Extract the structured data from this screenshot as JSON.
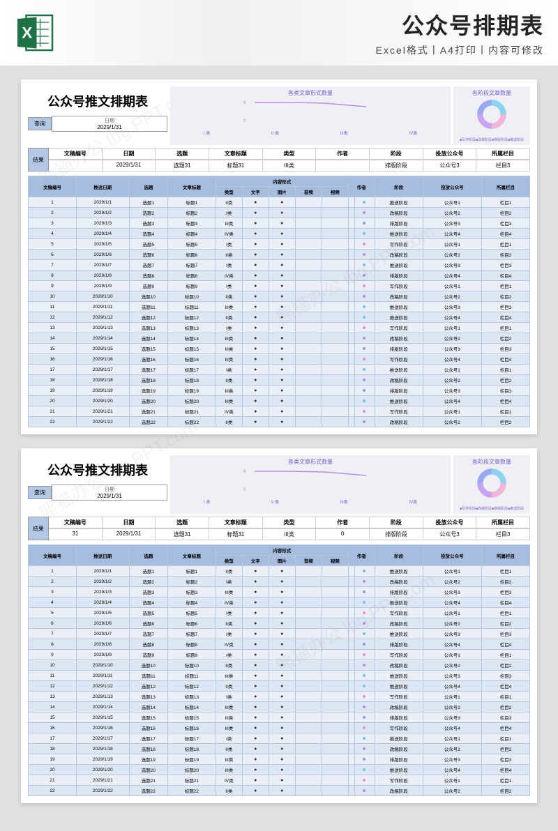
{
  "banner": {
    "title": "公众号排期表",
    "subtitle": "Excel格式丨A4打印丨内容可修改"
  },
  "sheetTitle": "公众号推文排期表",
  "query": {
    "label": "查询",
    "dateLabel": "日期",
    "date": "2029/1/31"
  },
  "result": {
    "label": "结果",
    "headers": [
      "文稿编号",
      "日期",
      "选题",
      "文章标题",
      "类型",
      "作者",
      "阶段",
      "投放公众号",
      "所属栏目"
    ],
    "values1": [
      "",
      "2029/1/31",
      "选题31",
      "标题31",
      "III类",
      "",
      "排版阶段",
      "公众号3",
      "栏目3"
    ],
    "values2": [
      "31",
      "2029/1/31",
      "选题31",
      "标题31",
      "III类",
      "0",
      "排版阶段",
      "公众号3",
      "栏目3"
    ]
  },
  "chart_data": [
    {
      "type": "line",
      "title": "各类文章形式数量",
      "categories": [
        "I 类",
        "II 类",
        "III类",
        "IV类"
      ],
      "values": [
        8,
        8,
        8,
        7
      ],
      "ylim": [
        0,
        8
      ],
      "yticks": [
        0,
        8
      ],
      "colors": {
        "line": "#b98ce8"
      }
    },
    {
      "type": "donut",
      "title": "各阶段文章数量",
      "series": [
        {
          "name": "写作阶段",
          "value": 25,
          "color": "#f0b5d8"
        },
        {
          "name": "改稿阶段",
          "value": 25,
          "color": "#c9a3ef"
        },
        {
          "name": "排版阶段",
          "value": 25,
          "color": "#9aa8f2"
        },
        {
          "name": "推送阶段",
          "value": 25,
          "color": "#8dd3ef"
        }
      ],
      "legend_labels": [
        "写作阶段",
        "改稿阶段",
        "排版阶段",
        "推送阶段"
      ]
    }
  ],
  "tableHeaders": {
    "id": "文稿编号",
    "date": "推送日期",
    "topic": "选题",
    "title": "文章标题",
    "formGroup": "内容形式",
    "type": "类型",
    "text": "文字",
    "image": "图片",
    "cover": "音频",
    "video": "视频",
    "author": "作者",
    "stage": "阶段",
    "account": "投放公众号",
    "column": "所属栏目"
  },
  "types": [
    "II类",
    "I类",
    "III类",
    "IV类",
    "I类",
    "II类",
    "I类",
    "IV类",
    "I类",
    "II类",
    "III类",
    "II类",
    "I类",
    "III类",
    "III类",
    "III类",
    "I类",
    "II类",
    "III类",
    "III类",
    "IV类",
    "II类"
  ],
  "stages": [
    "推送阶段",
    "改稿阶段",
    "排版阶段",
    "推送阶段",
    "写作阶段",
    "改稿阶段",
    "推送阶段",
    "排版阶段",
    "写作阶段",
    "改稿阶段",
    "推送阶段",
    "推送阶段",
    "写作阶段",
    "改稿阶段",
    "排版阶段",
    "写作阶段",
    "推送阶段",
    "改稿阶段",
    "排版阶段",
    "推送阶段",
    "写作阶段",
    "改稿阶段"
  ],
  "stageColors": {
    "写作阶段": "c1",
    "改稿阶段": "c2",
    "排版阶段": "c3",
    "推送阶段": "c4"
  },
  "rowCount": 22,
  "datePrefix": "2029/1/",
  "topicPrefix": "选题",
  "titlePrefix": "标题",
  "accountPrefix": "公众号",
  "columnPrefix": "栏目",
  "watermark": "熊猫办公 lbg.PPT.com"
}
